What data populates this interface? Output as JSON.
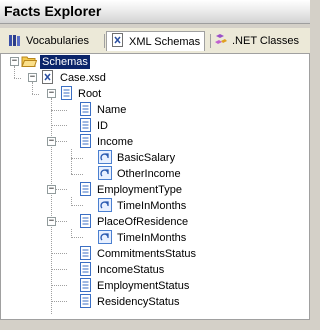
{
  "window": {
    "title": "Facts Explorer"
  },
  "tabs": [
    {
      "label": "Vocabularies",
      "icon": "books-icon"
    },
    {
      "label": "XML Schemas",
      "icon": "xml-schema-icon"
    },
    {
      "label": ".NET Classes",
      "icon": "dotnet-classes-icon"
    }
  ],
  "active_tab": "XML Schemas",
  "tree": {
    "schemas": "Schemas",
    "case_xsd": "Case.xsd",
    "root": "Root",
    "name": "Name",
    "id": "ID",
    "income": "Income",
    "basic_salary": "BasicSalary",
    "other_income": "OtherIncome",
    "employment_type": "EmploymentType",
    "time_in_months_1": "TimeInMonths",
    "place_of_residence": "PlaceOfResidence",
    "time_in_months_2": "TimeInMonths",
    "commitments_status": "CommitmentsStatus",
    "income_status": "IncomeStatus",
    "employment_status": "EmploymentStatus",
    "residency_status": "ResidencyStatus"
  },
  "colors": {
    "selection": "#0a246a",
    "folder": "#f3c94e",
    "node_icon": "#3b6fc4",
    "attribute_icon": "#4a7fd0"
  }
}
